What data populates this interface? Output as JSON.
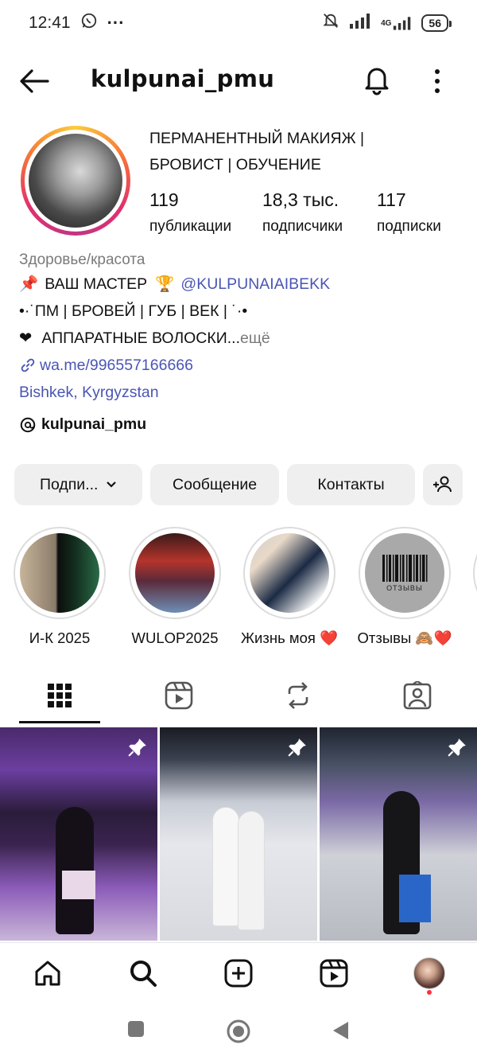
{
  "status_bar": {
    "time": "12:41",
    "dots": "···",
    "net": "4G",
    "battery": "56"
  },
  "topbar": {
    "username": "kulpunai_pmu"
  },
  "profile": {
    "name_line1": "ПЕРМАНЕНТНЫЙ МАКИЯЖ |",
    "name_line2": "БРОВИСТ | ОБУЧЕНИЕ",
    "stats": [
      {
        "value": "119",
        "label": "публикации"
      },
      {
        "value": "18,3 тыс.",
        "label": "подписчики"
      },
      {
        "value": "117",
        "label": "подписки"
      }
    ]
  },
  "bio": {
    "category": "Здоровье/красота",
    "line1_pin": "📌",
    "line1_text": "ВАШ МАСТЕР",
    "line1_trophy": "🏆",
    "line1_mention": "@KULPUNAIAIBEKK",
    "line2": "•·˙ПМ | БРОВЕЙ | ГУБ | ВЕК | ˙·•",
    "line3_heart": "❤",
    "line3_text": "АППАРАТНЫЕ ВОЛОСКИ...",
    "line3_more": " ещё",
    "link": "wa.me/996557166666",
    "location": "Bishkek, Kyrgyzstan",
    "threads": "kulpunai_pmu"
  },
  "actions": {
    "follow": "Подпи...",
    "message": "Сообщение",
    "contacts": "Контакты"
  },
  "highlights": [
    {
      "label": "И-К 2025"
    },
    {
      "label": "WULOP2025"
    },
    {
      "label": "Жизнь моя ❤️"
    },
    {
      "label": "Отзывы 🙈❤️"
    }
  ],
  "highlight_badge": "ОТЗЫВЫ",
  "colors": {
    "accent_link": "#4a55b4",
    "button_bg": "#efefef",
    "notif_dot": "#ff3040"
  }
}
